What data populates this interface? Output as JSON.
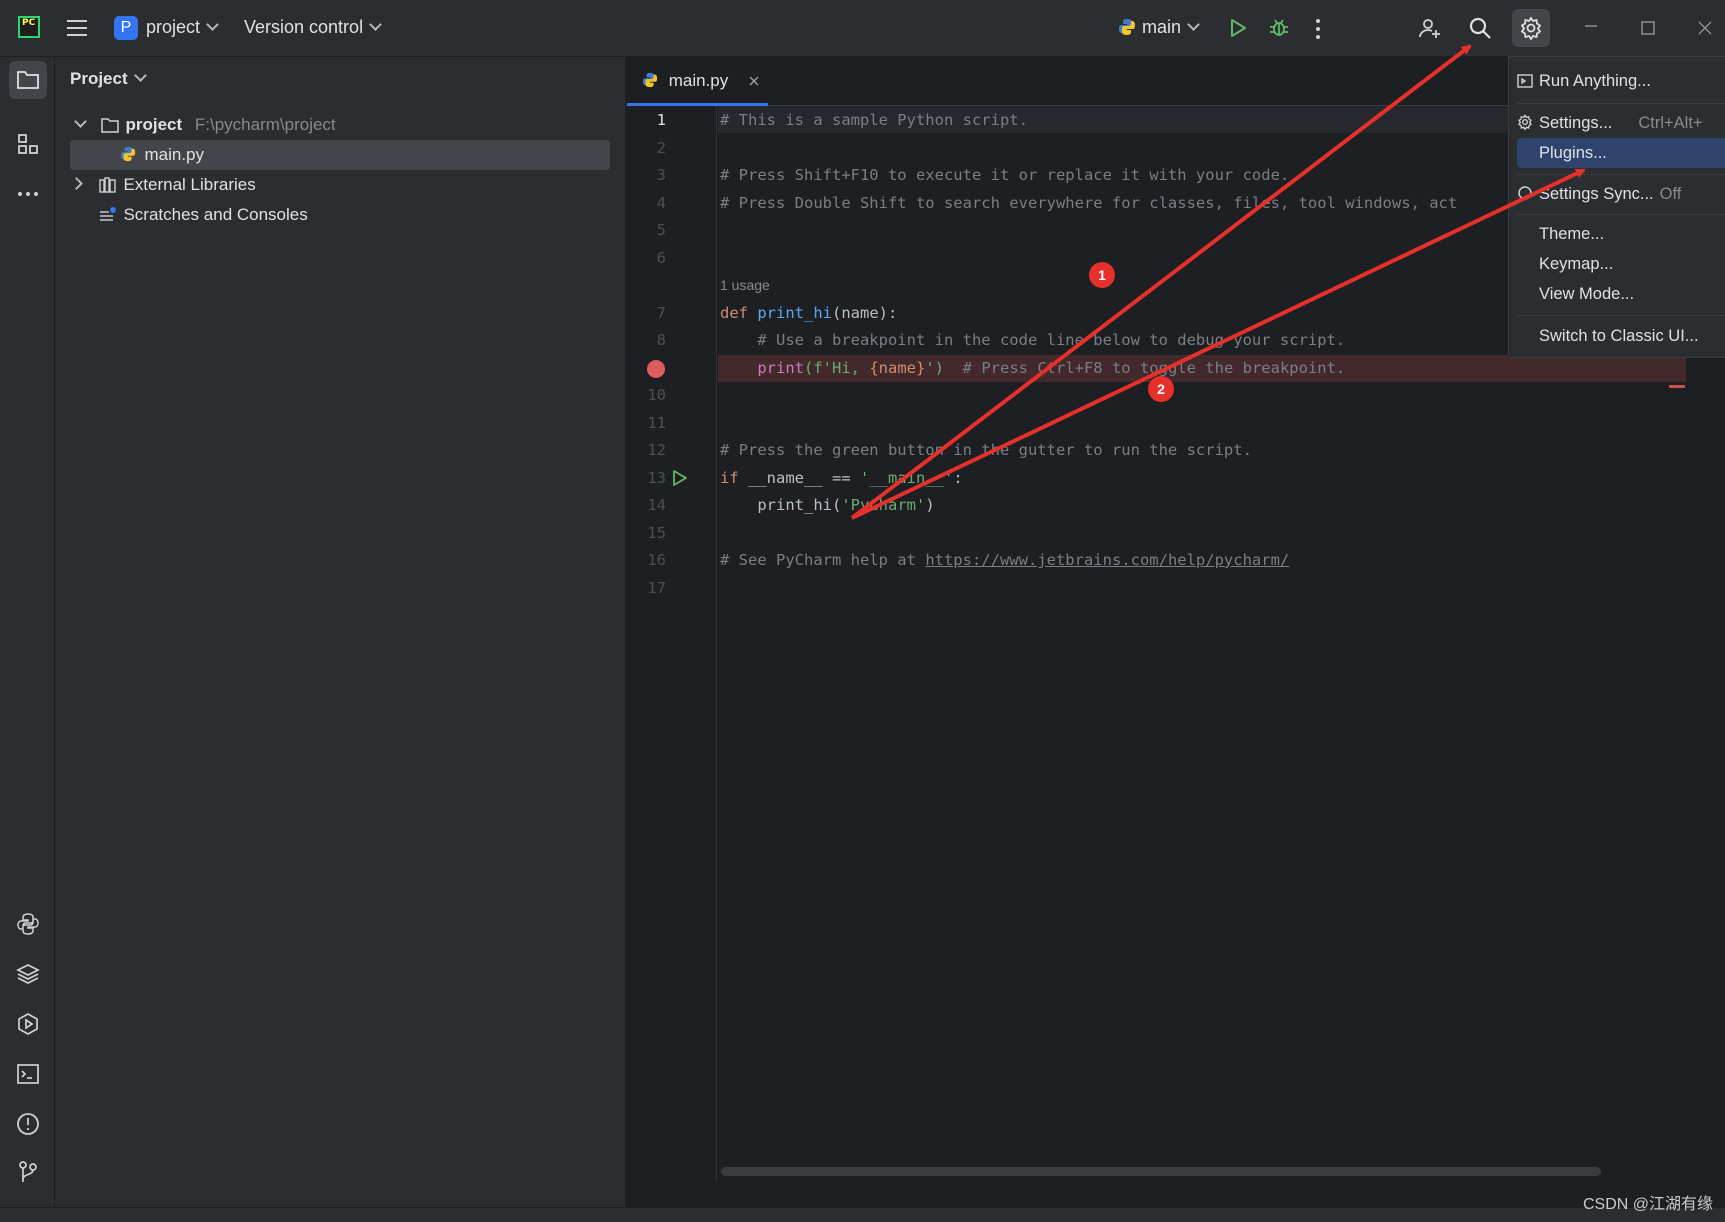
{
  "titlebar": {
    "project_badge": "P",
    "project_name": "project",
    "vcs_label": "Version control",
    "run_config": "main"
  },
  "project_panel": {
    "title": "Project",
    "tree": [
      {
        "label": "project",
        "path": "F:\\pycharm\\project"
      },
      {
        "label": "main.py"
      },
      {
        "label": "External Libraries"
      },
      {
        "label": "Scratches and Consoles"
      }
    ]
  },
  "editor": {
    "tab_label": "main.py",
    "usage_hint": "1 usage",
    "line_numbers": [
      "1",
      "2",
      "3",
      "4",
      "5",
      "6",
      "7",
      "8",
      "",
      "10",
      "11",
      "12",
      "13",
      "14",
      "15",
      "16",
      "17"
    ],
    "lines": {
      "l1": "# This is a sample Python script.",
      "l3": "# Press Shift+F10 to execute it or replace it with your code.",
      "l4": "# Press Double Shift to search everywhere for classes, files, tool windows, act",
      "l7_kw": "def",
      "l7_fn": "print_hi",
      "l7_rest": "(name):",
      "l8": "    # Use a breakpoint in the code line below to debug your script.",
      "l9_fn": "    print",
      "l9_str": "(f'Hi, ",
      "l9_var": "{name}",
      "l9_str2": "')",
      "l9_comment": "  # Press Ctrl+F8 to toggle the breakpoint.",
      "l12": "# Press the green button in the gutter to run the script.",
      "l13_kw": "if",
      "l13_rest": " __name__ == ",
      "l13_str": "'__main__'",
      "l13_end": ":",
      "l14_fn": "    print_hi(",
      "l14_str": "'PyCharm'",
      "l14_end": ")",
      "l16_prefix": "# See PyCharm help at ",
      "l16_link": "https://www.jetbrains.com/help/pycharm/"
    }
  },
  "menu": {
    "run_anything": "Run Anything...",
    "settings": "Settings...",
    "settings_shortcut": "Ctrl+Alt+",
    "plugins": "Plugins...",
    "settings_sync": "Settings Sync...",
    "settings_sync_state": "Off",
    "theme": "Theme...",
    "keymap": "Keymap...",
    "view_mode": "View Mode...",
    "switch_classic": "Switch to Classic UI..."
  },
  "annotations": {
    "badge1": "1",
    "badge2": "2",
    "color": "#e5302b"
  },
  "watermark": "CSDN @江湖有缘",
  "colors": {
    "accent": "#3574f0",
    "menu_highlight": "#2e436e",
    "breakpoint": "#db5c5c",
    "run_green": "#5fb865"
  }
}
